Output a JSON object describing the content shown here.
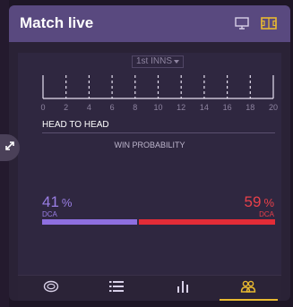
{
  "header": {
    "title": "Match live",
    "icons": [
      "monitor-icon",
      "pitch-icon"
    ]
  },
  "innings": {
    "selected": "1st INNS"
  },
  "timeline": {
    "ticks": [
      "0",
      "2",
      "4",
      "6",
      "8",
      "10",
      "12",
      "14",
      "16",
      "18",
      "20"
    ]
  },
  "head_to_head": {
    "title": "HEAD TO HEAD",
    "subtitle": "WIN PROBABILITY",
    "left": {
      "value": "41",
      "unit": "%",
      "team": "DCA",
      "fraction": 0.41,
      "color": "#8e6fe0"
    },
    "right": {
      "value": "59",
      "unit": "%",
      "team": "DCA",
      "fraction": 0.59,
      "color": "#e32c37"
    }
  },
  "tabs": [
    {
      "icon": "ball-icon"
    },
    {
      "icon": "list-icon"
    },
    {
      "icon": "bar-chart-icon"
    },
    {
      "icon": "players-icon",
      "active": true
    }
  ]
}
